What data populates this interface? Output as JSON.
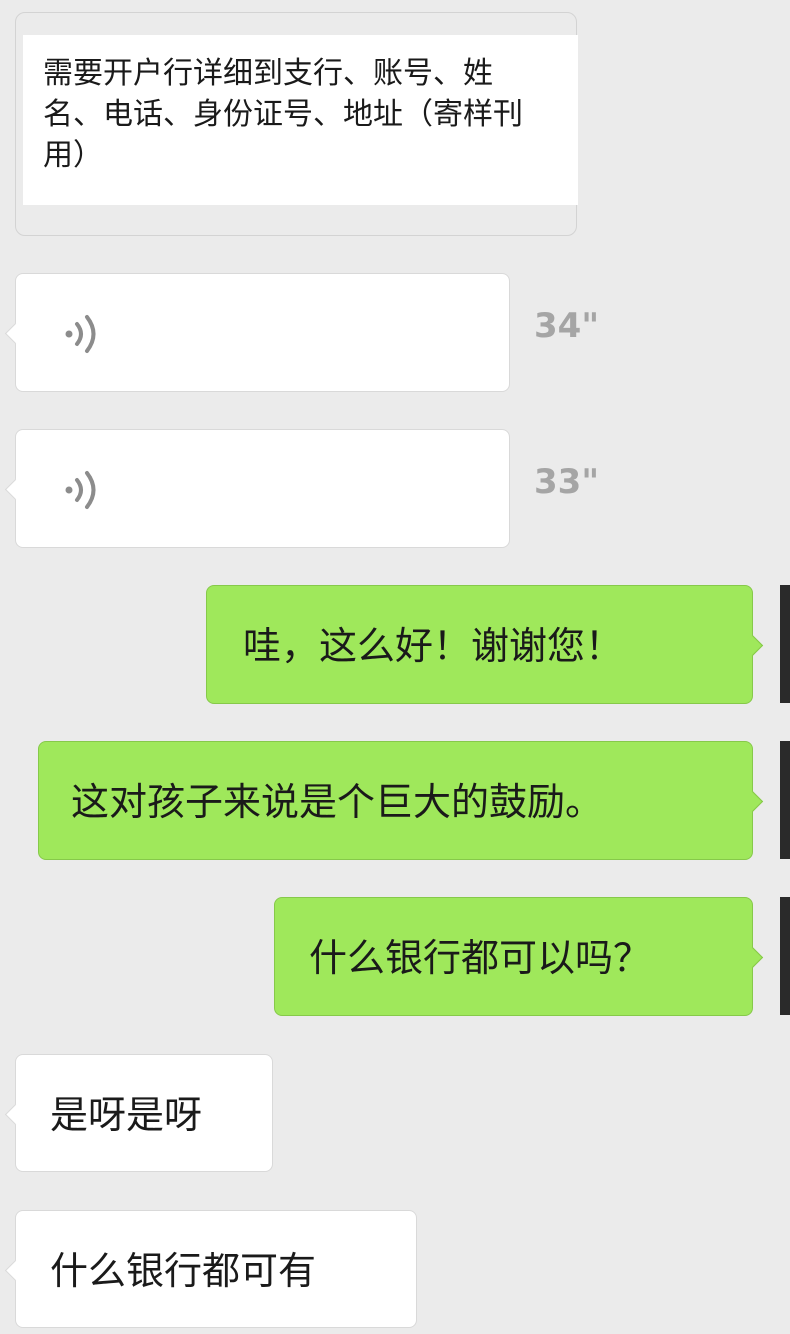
{
  "quoted_message": {
    "lines": [
      "需要开户行详细到支行、账号、姓",
      "名、电话、身份证号、地址（寄样刊",
      "用）"
    ]
  },
  "voice_messages": [
    {
      "duration": "34\"",
      "icon": "voice-wave-icon"
    },
    {
      "duration": "33\"",
      "icon": "voice-wave-icon"
    }
  ],
  "outgoing_messages": [
    {
      "text": "哇，这么好！谢谢您！"
    },
    {
      "text": "这对孩子来说是个巨大的鼓励。"
    },
    {
      "text": "什么银行都可以吗？"
    }
  ],
  "incoming_messages": [
    {
      "text": "是呀是呀"
    },
    {
      "text": "什么银行都可有"
    }
  ],
  "colors": {
    "background": "#ebebeb",
    "outgoing_bubble": "#9fe85b",
    "incoming_bubble": "#ffffff",
    "duration_text": "#a5a5a5"
  }
}
